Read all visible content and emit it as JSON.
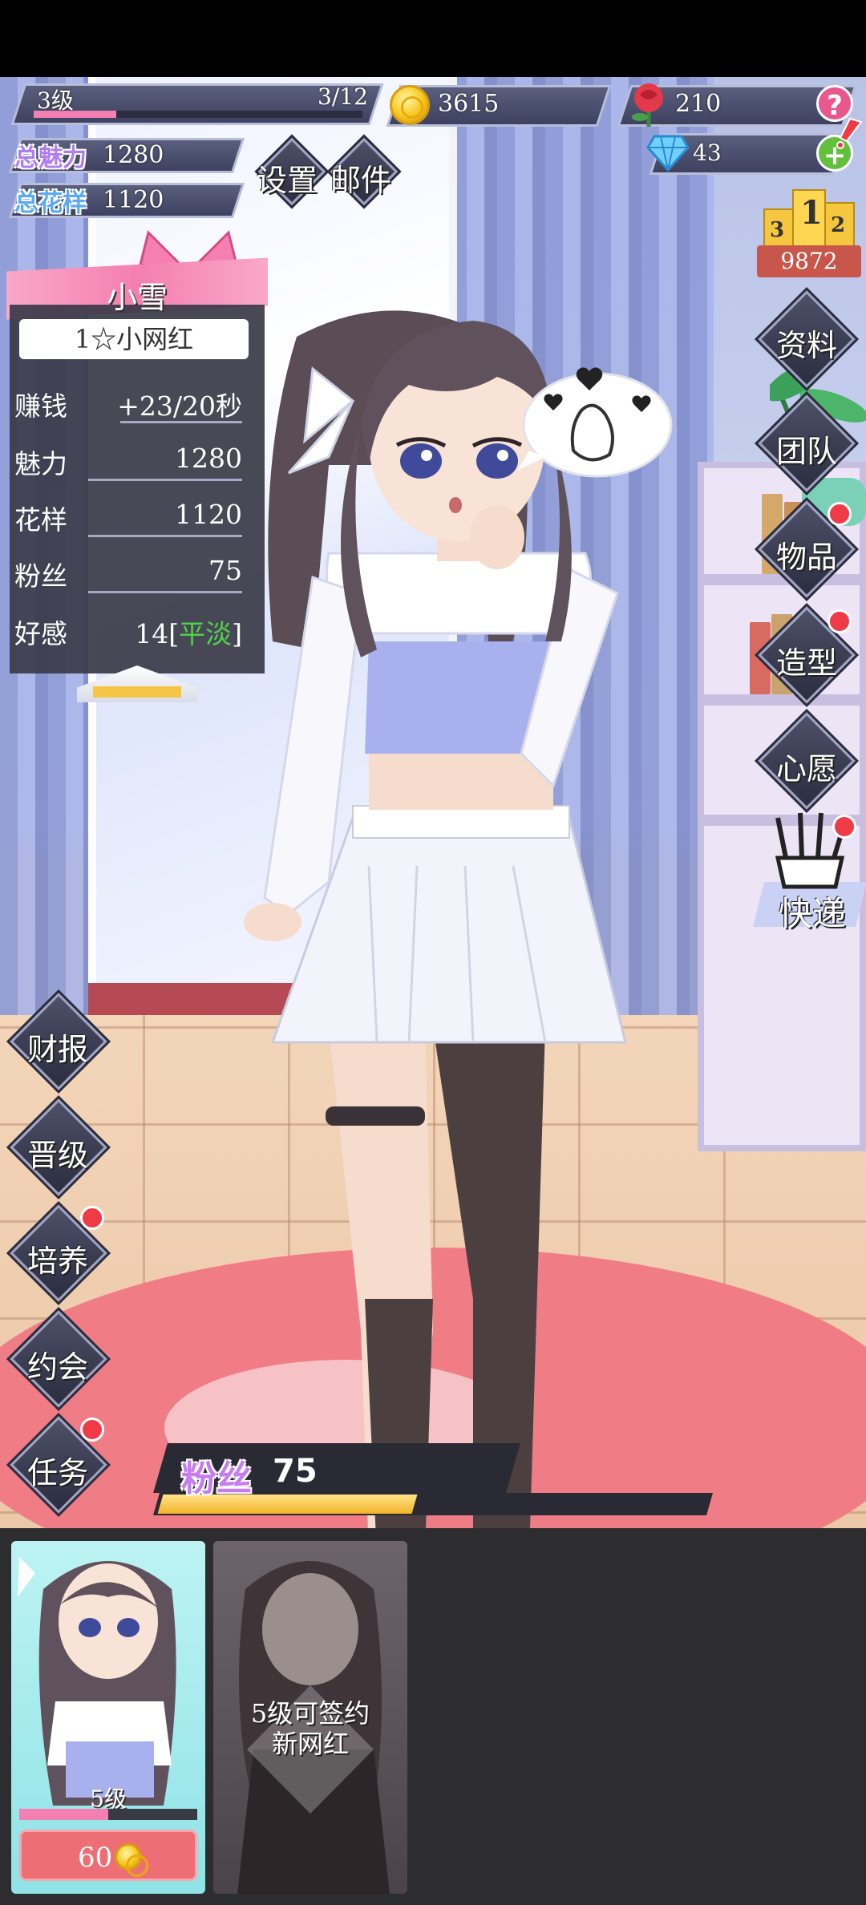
{
  "hud": {
    "level": "3级",
    "level_progress": "3/12",
    "level_progress_fraction": 0.25,
    "coins": "3615",
    "roses": "210",
    "diamonds": "43",
    "help_symbol": "?",
    "add_symbol": "+",
    "total_charm_label": "总魅力",
    "total_charm_value": "1280",
    "total_style_label": "总花样",
    "total_style_value": "1120",
    "settings_label": "设置",
    "mail_label": "邮件",
    "rank_score": "9872",
    "podium": [
      "3",
      "1",
      "2"
    ]
  },
  "profile": {
    "name": "小雪",
    "title": "1☆小网红",
    "stats": [
      {
        "label": "赚钱",
        "value": "+23/20秒"
      },
      {
        "label": "魅力",
        "value": "1280"
      },
      {
        "label": "花样",
        "value": "1120"
      },
      {
        "label": "粉丝",
        "value": "75"
      },
      {
        "label": "好感",
        "value": "14[",
        "mood": "平淡",
        "suffix": "]"
      }
    ]
  },
  "right_menu": [
    {
      "label": "资料",
      "dot": false
    },
    {
      "label": "团队",
      "dot": false
    },
    {
      "label": "物品",
      "dot": true
    },
    {
      "label": "造型",
      "dot": true
    },
    {
      "label": "心愿",
      "dot": false
    },
    {
      "label": "快递",
      "dot": true
    }
  ],
  "left_menu": [
    {
      "label": "财报",
      "dot": false
    },
    {
      "label": "晋级",
      "dot": false
    },
    {
      "label": "培养",
      "dot": true
    },
    {
      "label": "约会",
      "dot": false
    },
    {
      "label": "任务",
      "dot": true
    }
  ],
  "fans": {
    "label": "粉丝",
    "value": "75",
    "progress_fraction": 0.46
  },
  "cards": [
    {
      "level": "5级",
      "progress_fraction": 0.5,
      "price": "60"
    },
    {
      "locked_text_line1": "5级可签约",
      "locked_text_line2": "新网红"
    }
  ],
  "colors": {
    "hud_bar": "#3e4260",
    "accent_pink": "#f37fb3",
    "charm_purple": "#b07cf2",
    "style_blue": "#5aa9f5",
    "mood_green": "#4fd14a",
    "red_dot": "#ef3b45",
    "fans_label": "#c77cf2"
  }
}
